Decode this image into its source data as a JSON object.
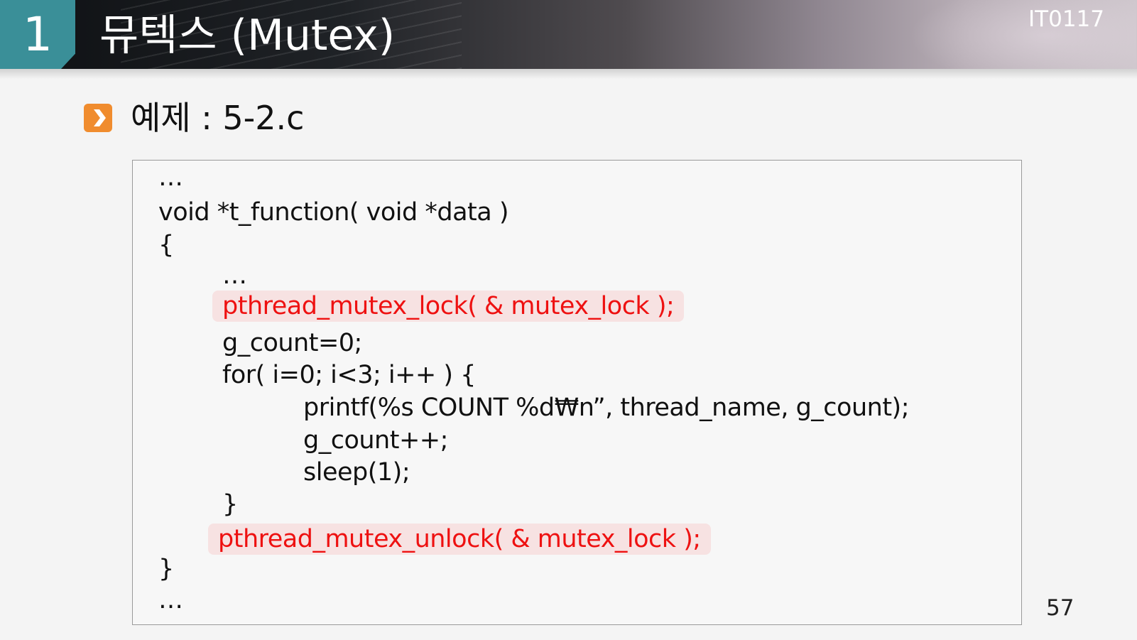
{
  "header": {
    "section_number": "1",
    "title": "뮤텍스 (Mutex)",
    "course_code": "IT0117"
  },
  "subtitle": "예제 : 5-2.c",
  "code": {
    "line_01": "…",
    "line_02": "void  *t_function( void  *data )",
    "line_03": "{",
    "line_04": "…",
    "line_05": "pthread_mutex_lock( & mutex_lock );",
    "line_06": "g_count=0;",
    "line_07": "for( i=0; i<3; i++ ) {",
    "line_08": "printf(%s  COUNT  %d₩n”, thread_name, g_count);",
    "line_09": "g_count++;",
    "line_10": "sleep(1);",
    "line_11": "}",
    "line_12": "pthread_mutex_unlock( & mutex_lock );",
    "line_13": "}",
    "line_14": "…"
  },
  "page_number": "57",
  "colors": {
    "section_badge": "#3a8f98",
    "bullet": "#f08c2e",
    "highlight_text": "#ee1111",
    "highlight_bg": "#f7e2e2"
  }
}
